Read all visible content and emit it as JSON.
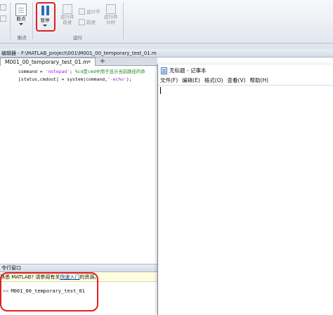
{
  "ribbon": {
    "breakpoints_label": "断点",
    "breakpoints_group": "断点",
    "pause_label": "暂停",
    "run_advance_label": [
      "运行并",
      "前进"
    ],
    "run_section_label": "运行节",
    "advance_label": "前进",
    "run_time_label": [
      "运行并",
      "计时"
    ],
    "run_group": "运行"
  },
  "editor": {
    "title": "编辑器 - F:\\MATLAB_project\\001\\M001_00_temporary_test_01.m",
    "tab_label": "M001_00_temporary_test_01.m",
    "tab_close": "×",
    "tab_add": "+",
    "code_lines": [
      {
        "pre": "command = ",
        "str": "'notepad'",
        "post": "; ",
        "cmt": "%cd是cmd中用于显示当前路径的命"
      },
      {
        "pre": "[status,cmdout] = system(command,",
        "str": "'-echo'",
        "post": ");",
        "cmt": ""
      }
    ]
  },
  "command_window": {
    "title": "令行窗口",
    "info_pre": "熟悉 MATLAB? 请参阅有关",
    "info_link": "快速入门",
    "info_post": "的资源。",
    "prompt": ">>",
    "command": "M001_00_temporary_test_01"
  },
  "notepad": {
    "title": "无标题 - 记事本",
    "menu": [
      "文件(F)",
      "编辑(E)",
      "格式(O)",
      "查看(V)",
      "帮助(H)"
    ]
  },
  "colors": {
    "highlight": "#e02020",
    "string": "#a020f0",
    "comment": "#228b22",
    "link": "#0645ad"
  }
}
